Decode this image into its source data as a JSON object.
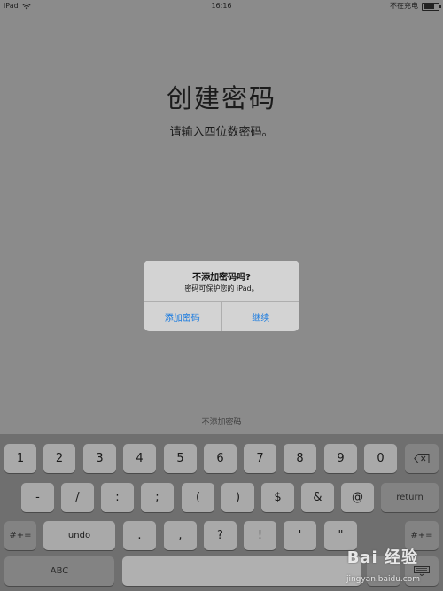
{
  "status_bar": {
    "device": "iPad",
    "time": "16:16",
    "charging": "不在充电"
  },
  "header": {
    "title": "创建密码",
    "subtitle": "请输入四位数密码。"
  },
  "alert": {
    "title": "不添加密码吗?",
    "message": "密码可保护您的 iPad。",
    "add_button": "添加密码",
    "continue_button": "继续"
  },
  "skip_link": "不添加密码",
  "keyboard": {
    "row1": [
      "1",
      "2",
      "3",
      "4",
      "5",
      "6",
      "7",
      "8",
      "9",
      "0"
    ],
    "row2": [
      "-",
      "/",
      ":",
      ";",
      "(",
      ")",
      "$",
      "&",
      "@"
    ],
    "return_label": "return",
    "row3_left": "#+=",
    "undo_label": "undo",
    "row3": [
      ".",
      ",",
      "?",
      "!",
      "'",
      "\""
    ],
    "row3_right": "#+=",
    "abc_label": "ABC"
  },
  "watermark": {
    "brand": "Bai 经验",
    "url": "jingyan.baidu.com"
  },
  "icons": {
    "wifi": "wifi-icon",
    "battery": "battery-icon",
    "delete": "delete-icon",
    "keyboard_hide": "keyboard-hide-icon"
  }
}
